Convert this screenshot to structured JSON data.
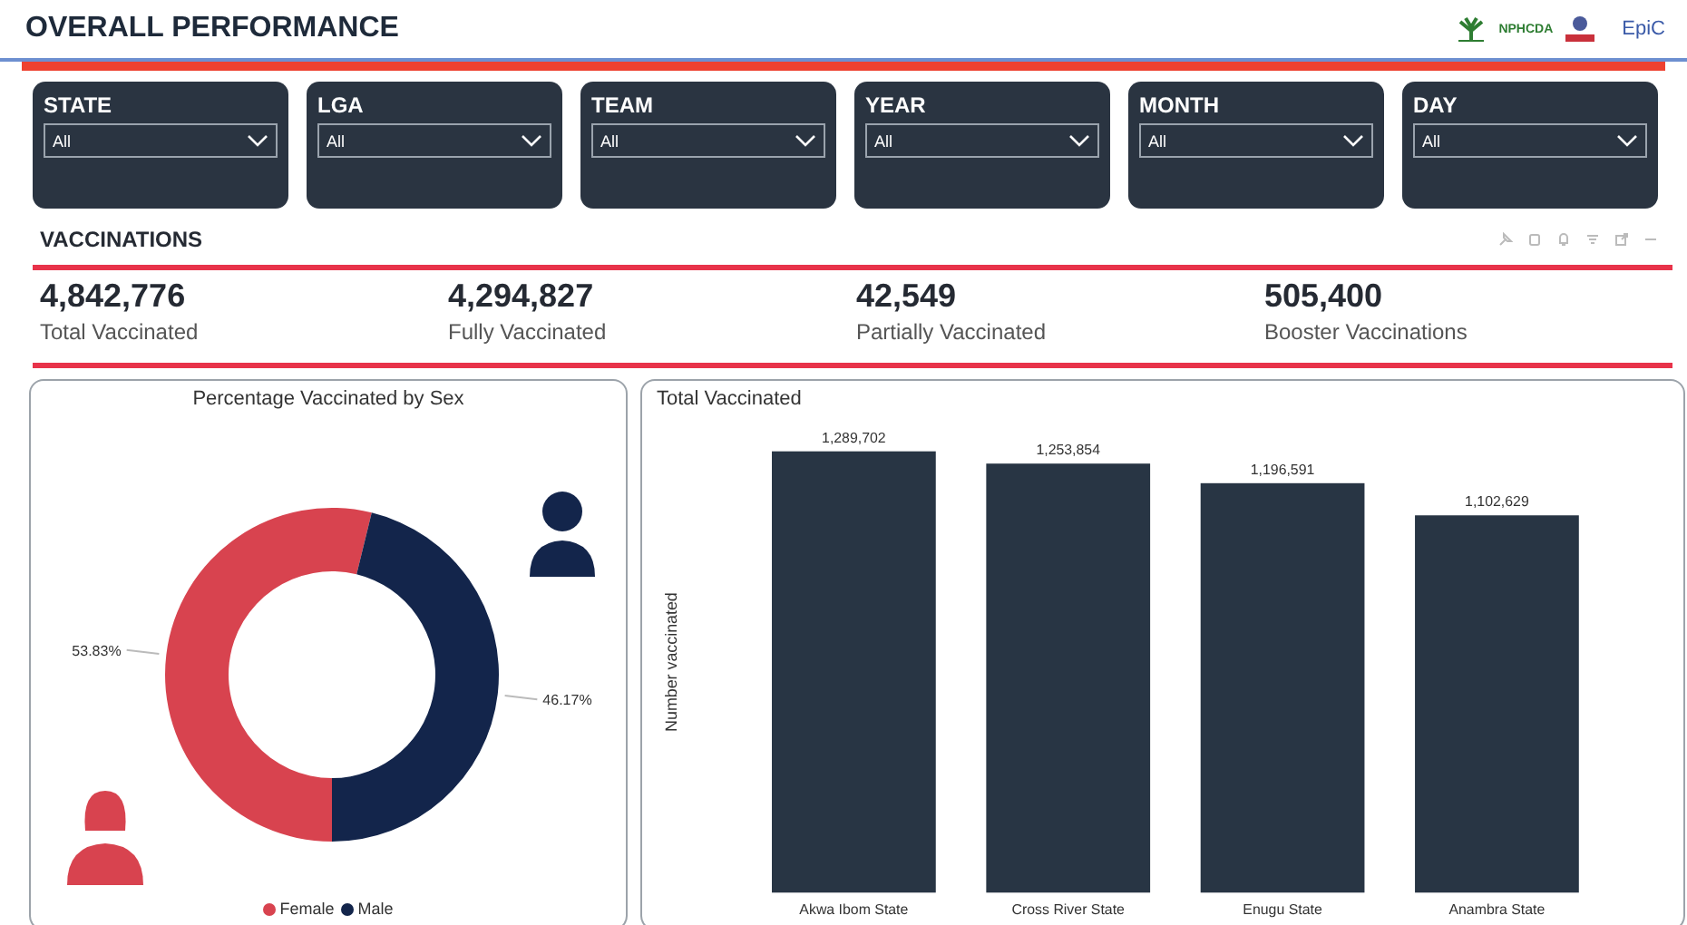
{
  "header": {
    "title": "OVERALL PERFORMANCE",
    "logo_left": "NPHCDA",
    "logo_right": "EpiC"
  },
  "slicers": [
    {
      "label": "STATE",
      "value": "All"
    },
    {
      "label": "LGA",
      "value": "All"
    },
    {
      "label": "TEAM",
      "value": "All"
    },
    {
      "label": "YEAR",
      "value": "All"
    },
    {
      "label": "MONTH",
      "value": "All"
    },
    {
      "label": "DAY",
      "value": "All"
    }
  ],
  "section": {
    "title": "VACCINATIONS"
  },
  "kpis": [
    {
      "value": "4,842,776",
      "label": "Total Vaccinated"
    },
    {
      "value": "4,294,827",
      "label": "Fully Vaccinated"
    },
    {
      "value": "42,549",
      "label": "Partially Vaccinated"
    },
    {
      "value": "505,400",
      "label": "Booster Vaccinations"
    }
  ],
  "sex_panel": {
    "chart_data": {
      "type": "donut",
      "title": "Percentage Vaccinated by Sex",
      "categories": [
        "Female",
        "Male"
      ],
      "colors": [
        "#d8434f",
        "#13254b"
      ],
      "values": [
        53.83,
        46.17
      ],
      "value_labels": [
        "53.83%",
        "46.17%"
      ]
    }
  },
  "total_panel": {
    "chart_data": {
      "type": "bar",
      "title": "Total Vaccinated",
      "ylabel": "Number vaccinated",
      "categories": [
        "Akwa Ibom State",
        "Cross River State",
        "Enugu State",
        "Anambra State"
      ],
      "values": [
        1289702,
        1253854,
        1196591,
        1102629
      ],
      "value_labels": [
        "1,289,702",
        "1,253,854",
        "1,196,591",
        "1,102,629"
      ]
    }
  }
}
